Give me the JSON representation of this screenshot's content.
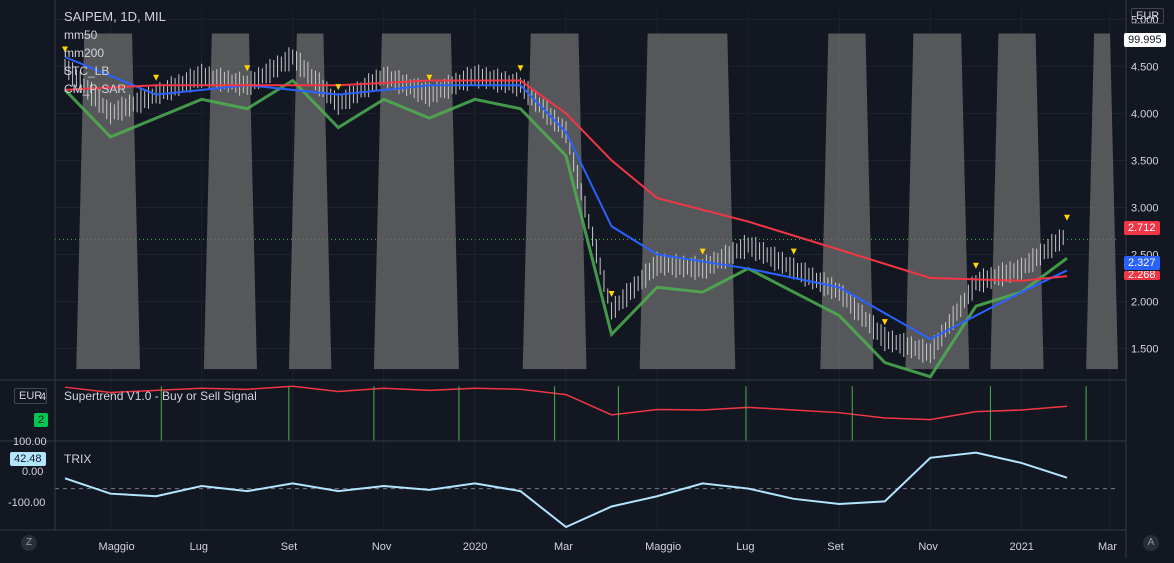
{
  "header": {
    "title": "SAIPEM, 1D, MIL",
    "indicators": [
      "mm50",
      "mm200",
      "STC_LB",
      "CM_P-SAR"
    ]
  },
  "price_scale": {
    "currency": "EUR",
    "top_value": "99.995",
    "ticks": [
      "5.000",
      "4.500",
      "4.000",
      "3.500",
      "3.000",
      "2.500",
      "2.000",
      "1.500"
    ],
    "last_price": "2.712",
    "mm50_value": "2.327",
    "mm200_value": "2.268"
  },
  "supertrend_pane": {
    "currency": "EUR",
    "label": "Supertrend V1.0 - Buy or Sell Signal",
    "tick": "4",
    "signal_badge": "2"
  },
  "trix_pane": {
    "label": "TRIX",
    "value_badge": "42.48",
    "ticks": [
      "100.00",
      "0.00",
      "-100.00"
    ]
  },
  "time_axis": {
    "labels": [
      "Maggio",
      "Lug",
      "Set",
      "Nov",
      "2020",
      "Mar",
      "Maggio",
      "Lug",
      "Set",
      "Nov",
      "2021",
      "Mar"
    ]
  },
  "corner": {
    "left": "Z",
    "right": "A"
  },
  "colors": {
    "background": "#131722",
    "candle": "#c8c8c8",
    "mm50": "#2962ff",
    "mm200": "#f23645",
    "stc_fill": "#6e6e6e",
    "psar": "#ffd600",
    "trend_up": "#4caf50",
    "trend_down": "#b71c1c",
    "trix": "#b3e5fc"
  },
  "chart_data": {
    "type": "line",
    "title": "SAIPEM, 1D, MIL",
    "x_range": [
      "2019-04",
      "2021-02"
    ],
    "ylim": [
      1.25,
      5.1
    ],
    "series": [
      {
        "name": "mm50",
        "x": [
          "2019-04",
          "2019-06",
          "2019-08",
          "2019-10",
          "2019-12",
          "2020-02",
          "2020-03",
          "2020-04",
          "2020-05",
          "2020-07",
          "2020-09",
          "2020-11",
          "2021-01",
          "2021-02"
        ],
        "values": [
          4.6,
          4.2,
          4.3,
          4.2,
          4.3,
          4.3,
          3.8,
          2.8,
          2.5,
          2.35,
          2.15,
          1.6,
          2.1,
          2.33
        ]
      },
      {
        "name": "mm200",
        "x": [
          "2019-04",
          "2019-06",
          "2019-08",
          "2019-10",
          "2019-12",
          "2020-02",
          "2020-03",
          "2020-04",
          "2020-05",
          "2020-07",
          "2020-09",
          "2020-11",
          "2021-01",
          "2021-02"
        ],
        "values": [
          4.25,
          4.3,
          4.3,
          4.3,
          4.35,
          4.35,
          4.0,
          3.5,
          3.1,
          2.85,
          2.55,
          2.25,
          2.22,
          2.27
        ]
      },
      {
        "name": "SAIPEM",
        "x": [
          "2019-04",
          "2019-05",
          "2019-06",
          "2019-07",
          "2019-08",
          "2019-09",
          "2019-10",
          "2019-11",
          "2019-12",
          "2020-01",
          "2020-02",
          "2020-03",
          "2020-04",
          "2020-05",
          "2020-06",
          "2020-07",
          "2020-08",
          "2020-09",
          "2020-10",
          "2020-11",
          "2020-12",
          "2021-01",
          "2021-02"
        ],
        "values": [
          4.5,
          4.0,
          4.2,
          4.4,
          4.3,
          4.6,
          4.1,
          4.4,
          4.2,
          4.4,
          4.3,
          3.8,
          1.9,
          2.4,
          2.35,
          2.6,
          2.35,
          2.1,
          1.6,
          1.45,
          2.2,
          2.35,
          2.71
        ]
      }
    ],
    "supertrend": {
      "ylim": [
        0,
        4
      ],
      "badge": 2
    },
    "trix": {
      "ylim": [
        -150,
        170
      ],
      "x": [
        "2019-04",
        "2019-05",
        "2019-06",
        "2019-07",
        "2019-08",
        "2019-09",
        "2019-10",
        "2019-11",
        "2019-12",
        "2020-01",
        "2020-02",
        "2020-03",
        "2020-04",
        "2020-05",
        "2020-06",
        "2020-07",
        "2020-08",
        "2020-09",
        "2020-10",
        "2020-11",
        "2020-12",
        "2021-01",
        "2021-02"
      ],
      "values": [
        40,
        -20,
        -30,
        10,
        -10,
        20,
        -10,
        10,
        -5,
        20,
        -10,
        -150,
        -70,
        -30,
        20,
        0,
        -40,
        -60,
        -50,
        120,
        140,
        100,
        42.48
      ]
    }
  }
}
